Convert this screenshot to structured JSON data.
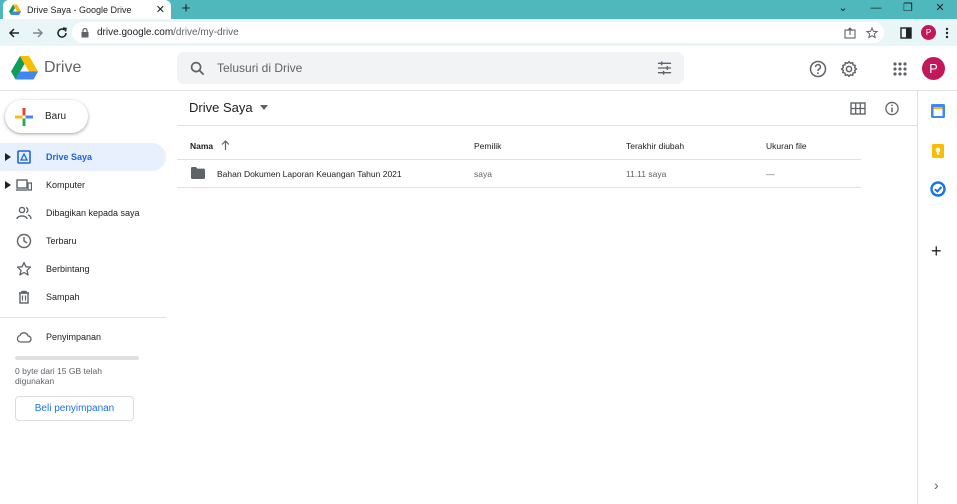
{
  "browser": {
    "tab_title": "Drive Saya - Google Drive",
    "tab_close": "✕",
    "new_tab": "+",
    "url_host": "drive.google.com",
    "url_path": "/drive/my-drive",
    "profile_initial": "P",
    "window_controls": {
      "dropdown": "⌄",
      "minimize": "—",
      "restore": "❐",
      "close": "✕"
    }
  },
  "header": {
    "brand": "Drive",
    "search_placeholder": "Telusuri di Drive",
    "avatar_initial": "P"
  },
  "sidebar": {
    "new_button": "Baru",
    "items": [
      {
        "label": "Drive Saya",
        "active": true
      },
      {
        "label": "Komputer",
        "active": false
      },
      {
        "label": "Dibagikan kepada saya",
        "active": false
      },
      {
        "label": "Terbaru",
        "active": false
      },
      {
        "label": "Berbintang",
        "active": false
      },
      {
        "label": "Sampah",
        "active": false
      }
    ],
    "storage_label": "Penyimpanan",
    "storage_used_fraction": 0.0,
    "storage_usage": "0 byte dari 15 GB telah digunakan",
    "buy_storage": "Beli penyimpanan"
  },
  "main": {
    "breadcrumb": "Drive Saya",
    "columns": {
      "name": "Nama",
      "owner": "Pemilik",
      "modified": "Terakhir diubah",
      "size": "Ukuran file"
    },
    "rows": [
      {
        "name": "Bahan Dokumen Laporan Keuangan Tahun 2021",
        "owner": "saya",
        "modified": "11.11 saya",
        "size": "—"
      }
    ]
  },
  "side_panel": {
    "add": "+",
    "more": "›"
  },
  "colors": {
    "accent": "#1a73e8",
    "active_nav_bg": "#e8f0fe",
    "active_nav_text": "#1967d2",
    "tab_strip": "#4fb8bd",
    "avatar": "#c2185b"
  }
}
